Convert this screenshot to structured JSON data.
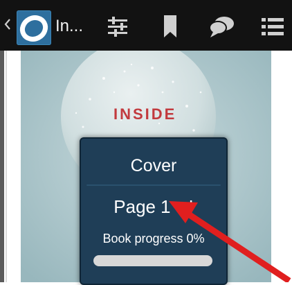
{
  "toolbar": {
    "title": "In...",
    "back_icon": "back-arrow-icon",
    "app_icon": "overdrive-logo-icon",
    "settings_icon": "sliders-icon",
    "bookmark_icon": "bookmark-icon",
    "notes_icon": "chat-bubbles-icon",
    "menu_icon": "list-menu-icon"
  },
  "cover": {
    "title": "INSIDE"
  },
  "popup": {
    "cover_label": "Cover",
    "page_label": "Page",
    "page_number": "1",
    "page_suffix": "I",
    "progress_label": "Book progress 0%",
    "progress_fraction": 0
  },
  "colors": {
    "toolbar_bg": "#121212",
    "popup_bg": "#1f3e57",
    "accent_arrow": "#e01f1f",
    "cover_title": "#c23a3e",
    "progress_fill": "#1aa3d9"
  }
}
